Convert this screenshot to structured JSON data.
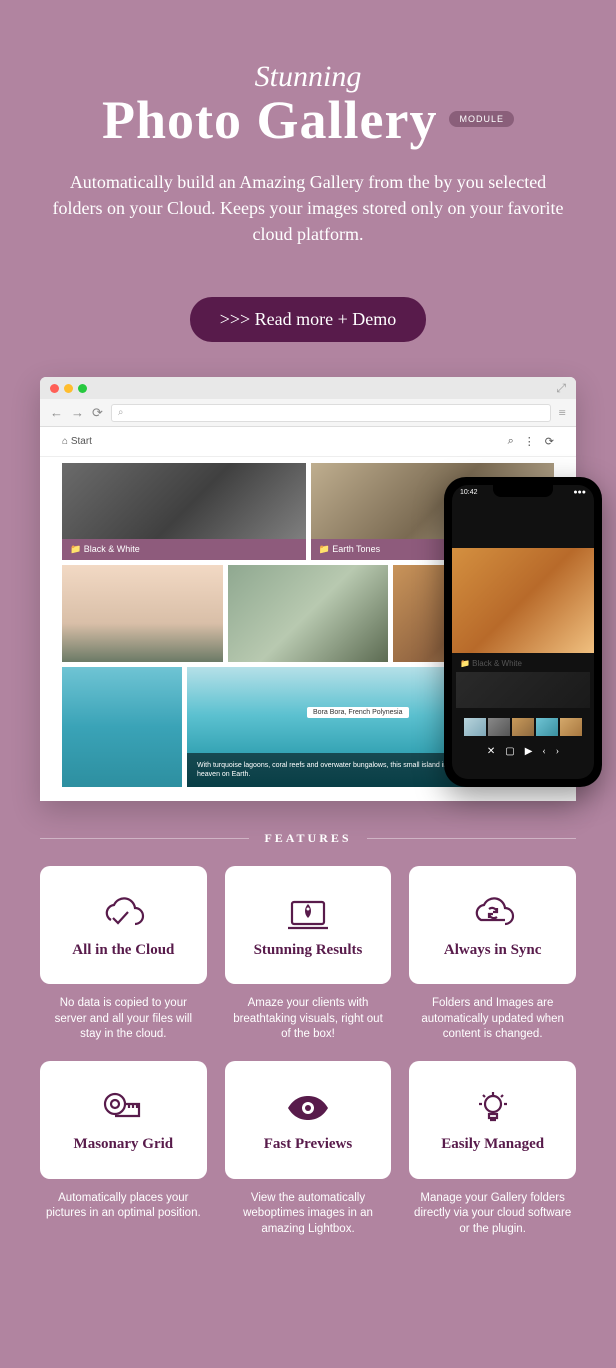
{
  "header": {
    "subtitle": "Stunning",
    "title": "Photo Gallery",
    "badge": "MODULE",
    "description": "Automatically build an Amazing Gallery from the by you selected folders on your Cloud. Keeps your images stored only on your favorite cloud platform."
  },
  "cta": ">>> Read more + Demo",
  "browser": {
    "url_search_icon": "⌕",
    "toolbar_home": "⌂  Start",
    "toolbar_icons": [
      "⌕",
      "⋮",
      "⟳"
    ],
    "captions": {
      "bw": "📁 Black & White",
      "earth": "📁 Earth Tones"
    },
    "featured_pill": "Bora Bora, French Polynesia",
    "featured_caption": "With turquoise lagoons, coral reefs and overwater bungalows, this small island in the South Pacific is basically heaven on Earth."
  },
  "phone": {
    "time": "10:42",
    "title": "📁 Black & White",
    "controls": [
      "✕",
      "▢",
      "▶",
      "‹",
      "›"
    ]
  },
  "features_label": "FEATURES",
  "features": [
    {
      "title": "All in the Cloud",
      "desc": "No data is copied to your server and all your files will stay in the cloud."
    },
    {
      "title": "Stunning Results",
      "desc": "Amaze your clients with breathtaking visuals, right out of the box!"
    },
    {
      "title": "Always in Sync",
      "desc": "Folders and Images are automatically updated when content is changed."
    },
    {
      "title": "Masonary Grid",
      "desc": "Automatically places your pictures in an optimal position."
    },
    {
      "title": "Fast Previews",
      "desc": "View the automatically weboptimes images in an amazing Lightbox."
    },
    {
      "title": "Easily Managed",
      "desc": "Manage your Gallery folders directly via your cloud software or the plugin."
    }
  ]
}
